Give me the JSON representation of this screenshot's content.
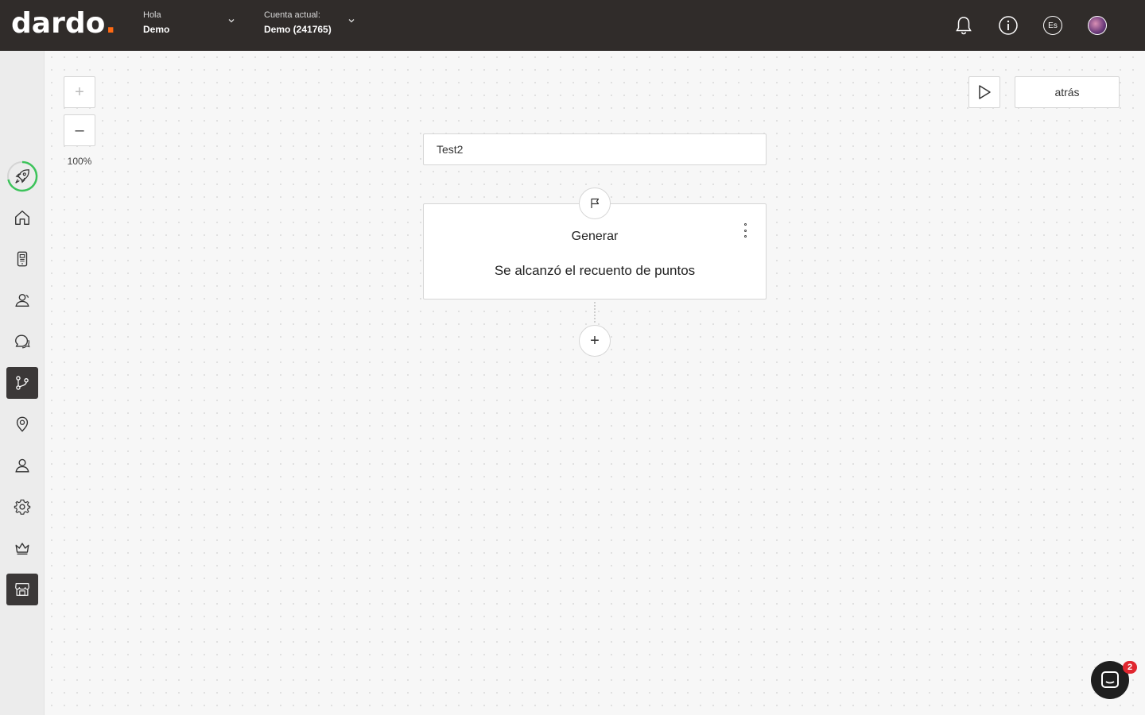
{
  "app": {
    "logo_text": "dardo",
    "logo_dot": ".",
    "brand_color": "#ff6a13"
  },
  "header": {
    "greeting_label": "Hola",
    "user_name": "Demo",
    "account_label": "Cuenta actual:",
    "account_name": "Demo (241765)",
    "language_badge": "Es",
    "icons": [
      "bell-icon",
      "info-icon",
      "language-icon",
      "avatar"
    ]
  },
  "sidebar": {
    "items": [
      {
        "name": "rocket-icon",
        "active": false,
        "progress": 0.75
      },
      {
        "name": "home-icon",
        "active": false
      },
      {
        "name": "mobile-card-icon",
        "active": false
      },
      {
        "name": "users-icon",
        "active": false
      },
      {
        "name": "chat-icon",
        "active": false
      },
      {
        "name": "flows-icon",
        "active": true
      },
      {
        "name": "location-icon",
        "active": false
      },
      {
        "name": "user-icon",
        "active": false
      },
      {
        "name": "gear-icon",
        "active": false
      },
      {
        "name": "crown-icon",
        "active": false
      },
      {
        "name": "store-icon",
        "active": true
      }
    ]
  },
  "canvas": {
    "zoom_level": "100%",
    "zoom_in": "+",
    "zoom_out": "–",
    "back_label": "atrás",
    "flow_name": "Test2",
    "node": {
      "title": "Generar",
      "description": "Se alcanzó el recuento de puntos"
    },
    "add_step": "+"
  },
  "chat": {
    "unread_count": "2"
  }
}
